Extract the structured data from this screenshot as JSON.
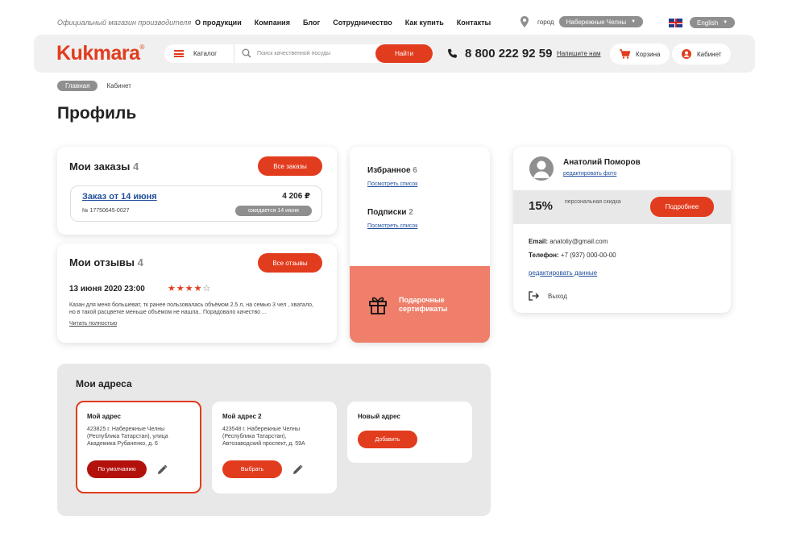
{
  "topbar": {
    "tagline": "Официальный магазин производителя",
    "nav": [
      "О продукции",
      "Компания",
      "Блог",
      "Сотрудничество",
      "Как купить",
      "Контакты"
    ],
    "city_label": "город",
    "city_value": "Набережные Челны",
    "language": "English"
  },
  "header": {
    "logo": "Kukmara",
    "catalog_label": "Каталог",
    "search_placeholder": "Поиск качественной посуды",
    "search_button": "Найти",
    "phone": "8 800 222 92 59",
    "write_us": "Напишите нам",
    "cart_label": "Корзина",
    "cabinet_label": "Кабинет"
  },
  "breadcrumb": {
    "home": "Главная",
    "current": "Кабинет"
  },
  "page_title": "Профиль",
  "orders": {
    "title": "Мои заказы",
    "count": "4",
    "all_button": "Все заказы",
    "item": {
      "title": "Заказ от 14 июня",
      "number": "№ 17750645-0027",
      "sum": "4 206 ₽",
      "status": "ожидается 14 июня"
    }
  },
  "reviews": {
    "title": "Мои отзывы",
    "count": "4",
    "all_button": "Все отзывы",
    "item": {
      "date": "13 июня 2020  23:00",
      "rating": 4,
      "rating_max": 5,
      "text": "Казан для меня большеват, тк ранее пользовалась объёмом 2.5 л, на семью 3 чел , хватало, но в такой расцветке меньше объёмом не нашла.. Порадовало качество ...",
      "read_more": "Читать полностью"
    }
  },
  "favorites": {
    "title": "Избранное",
    "count": "6",
    "link": "Посмотреть список"
  },
  "subscriptions": {
    "title": "Подписки",
    "count": "2",
    "link": "Посмотреть список"
  },
  "gift": {
    "label": "Подарочные сертификаты"
  },
  "profile": {
    "name": "Анатолий Поморов",
    "edit_photo": "редактировать фото",
    "discount_value": "15%",
    "discount_label": "персональная скидка",
    "discount_button": "Подробнее",
    "email_label": "Email:",
    "email": "anatoliy@gmail.com",
    "phone_label": "Телефон:",
    "phone": "+7 (937) 000-00-00",
    "edit_data": "редактировать данные",
    "logout": "Выход"
  },
  "addresses": {
    "title": "Мои адреса",
    "items": [
      {
        "name": "Мой адрес",
        "text": "423825 г. Набережные Челны (Республика Татарстан), улица Академика Рубаненко, д. 6",
        "button": "По умолчанию"
      },
      {
        "name": "Мой адрес 2",
        "text": "423548 г. Набережные Челны (Республика Татарстан), Автозаводский проспект, д. 59А",
        "button": "Выбрать"
      }
    ],
    "new_title": "Новый адрес",
    "add_button": "Добавить"
  },
  "colors": {
    "accent": "#e23c1e",
    "accent_dark": "#b3120c",
    "gift_bg": "#ef7f6a",
    "gray_pill": "#8f8f8f",
    "link": "#1f4e9c"
  }
}
